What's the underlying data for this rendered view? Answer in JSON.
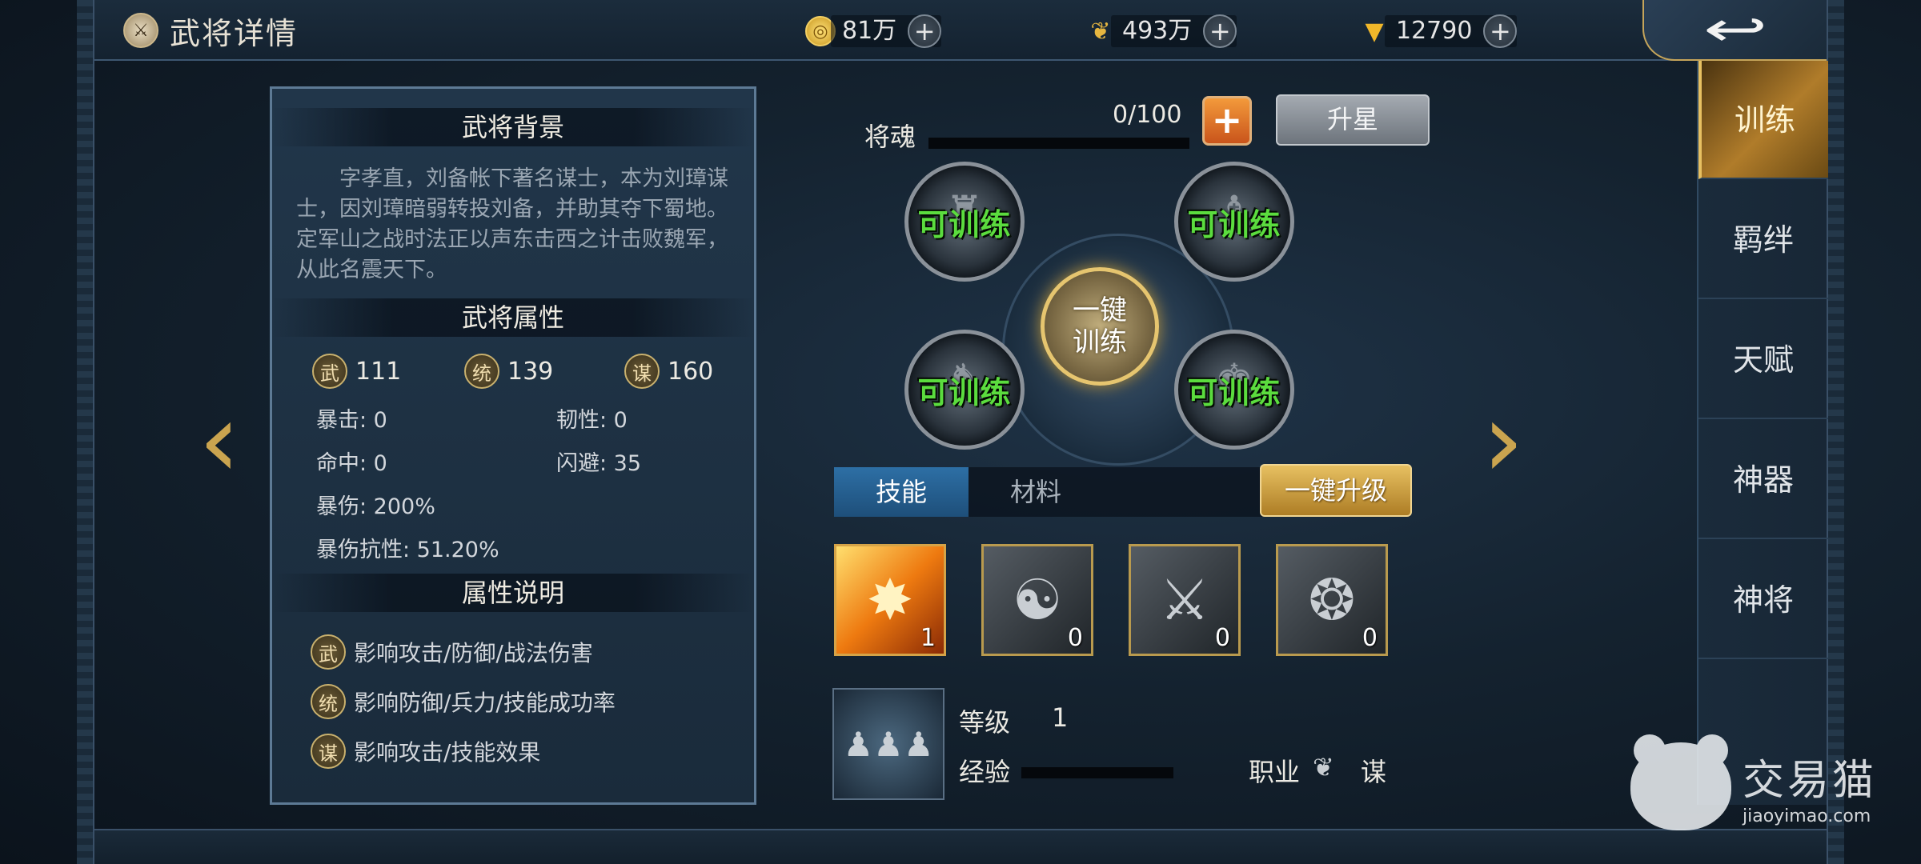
{
  "header": {
    "title": "武将详情",
    "resources": [
      {
        "icon": "coin-icon",
        "value": "81万"
      },
      {
        "icon": "grain-icon",
        "value": "493万"
      },
      {
        "icon": "ingot-icon",
        "value": "12790"
      }
    ],
    "plus_label": "+"
  },
  "background": {
    "title": "武将背景",
    "text": "字孝直，刘备帐下著名谋士，本为刘璋谋士，因刘璋暗弱转投刘备，并助其夺下蜀地。定军山之战时法正以声东击西之计击败魏军，从此名震天下。"
  },
  "attributes": {
    "title": "武将属性",
    "main": [
      {
        "icon_text": "武",
        "value": "111"
      },
      {
        "icon_text": "统",
        "value": "139"
      },
      {
        "icon_text": "谋",
        "value": "160"
      }
    ],
    "crit": "暴击:  0",
    "toughness": "韧性:  0",
    "hit": "命中:  0",
    "dodge": "闪避:  35",
    "crit_dmg": "暴伤:  200%",
    "crit_resist": "暴伤抗性:  51.20%"
  },
  "attr_desc": {
    "title": "属性说明",
    "items": [
      {
        "icon_text": "武",
        "text": "影响攻击/防御/战法伤害"
      },
      {
        "icon_text": "统",
        "text": "影响防御/兵力/技能成功率"
      },
      {
        "icon_text": "谋",
        "text": "影响攻击/技能效果"
      }
    ]
  },
  "soul": {
    "label": "将魂",
    "value": "0/100",
    "fraction": 0,
    "plus_label": "+",
    "star_button": "升星"
  },
  "training": {
    "node_label": "可训练",
    "one_key_line1": "一键",
    "one_key_line2": "训练"
  },
  "tabs": {
    "skill": "技能",
    "material": "材料",
    "upgrade_button": "一键升级"
  },
  "skills": [
    {
      "icon": "fire-slash-icon",
      "level": "1"
    },
    {
      "icon": "meditate-icon",
      "level": "0"
    },
    {
      "icon": "sword-icon",
      "level": "0"
    },
    {
      "icon": "whirlwind-icon",
      "level": "0"
    }
  ],
  "troop": {
    "level_label": "等级",
    "level_value": "1",
    "exp_label": "经验",
    "job_label": "职业",
    "job_value": "谋"
  },
  "side_nav": {
    "items": [
      "训练",
      "羁绊",
      "天赋",
      "神器",
      "神将"
    ],
    "active_index": 0
  },
  "watermark": {
    "cn": "交易猫",
    "en": "jiaoyimao.com"
  },
  "colors": {
    "gold": "#caa44f",
    "train_green": "#5bdc3e",
    "tab_active": "#2d6fa5"
  }
}
